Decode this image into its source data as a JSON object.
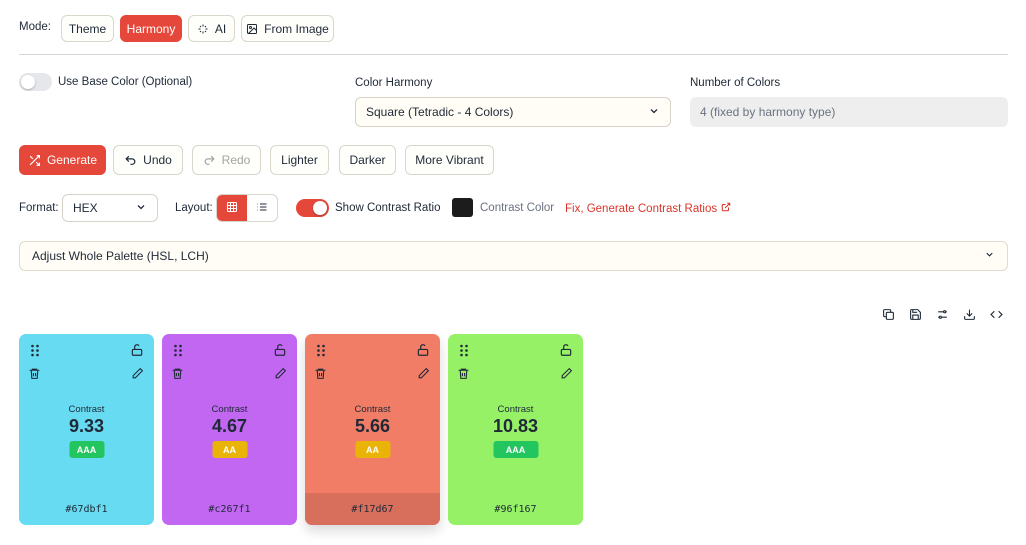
{
  "mode": {
    "label": "Mode:",
    "options": [
      {
        "label": "Theme"
      },
      {
        "label": "Harmony"
      },
      {
        "label": "AI"
      },
      {
        "label": "From Image"
      }
    ],
    "active": "Harmony"
  },
  "base_color": {
    "label": "Use Base Color (Optional)",
    "enabled": false
  },
  "harmony": {
    "label": "Color Harmony",
    "value": "Square (Tetradic - 4 Colors)"
  },
  "num_colors": {
    "label": "Number of Colors",
    "placeholder": "4 (fixed by harmony type)"
  },
  "actions": {
    "generate": "Generate",
    "undo": "Undo",
    "redo": "Redo",
    "lighter": "Lighter",
    "darker": "Darker",
    "more_vibrant": "More Vibrant"
  },
  "format": {
    "label": "Format:",
    "value": "HEX"
  },
  "layout": {
    "label": "Layout:",
    "active": "grid"
  },
  "contrast": {
    "show_label": "Show Contrast Ratio",
    "enabled": true,
    "color_label": "Contrast Color",
    "color": "#1c1c1c",
    "fix_link": "Fix, Generate Contrast Ratios"
  },
  "adjust": {
    "label": "Adjust Whole Palette (HSL, LCH)"
  },
  "colors": {
    "accent": "#e5473a",
    "aaa_badge": "#22c55e",
    "aa_badge": "#eab308"
  },
  "cards": [
    {
      "hex": "#67dbf1",
      "contrast_label": "Contrast",
      "ratio": "9.33",
      "rating": "AAA"
    },
    {
      "hex": "#c267f1",
      "contrast_label": "Contrast",
      "ratio": "4.67",
      "rating": "AA"
    },
    {
      "hex": "#f17d67",
      "contrast_label": "Contrast",
      "ratio": "5.66",
      "rating": "AA"
    },
    {
      "hex": "#96f167",
      "contrast_label": "Contrast",
      "ratio": "10.83",
      "rating": "AAA"
    }
  ]
}
